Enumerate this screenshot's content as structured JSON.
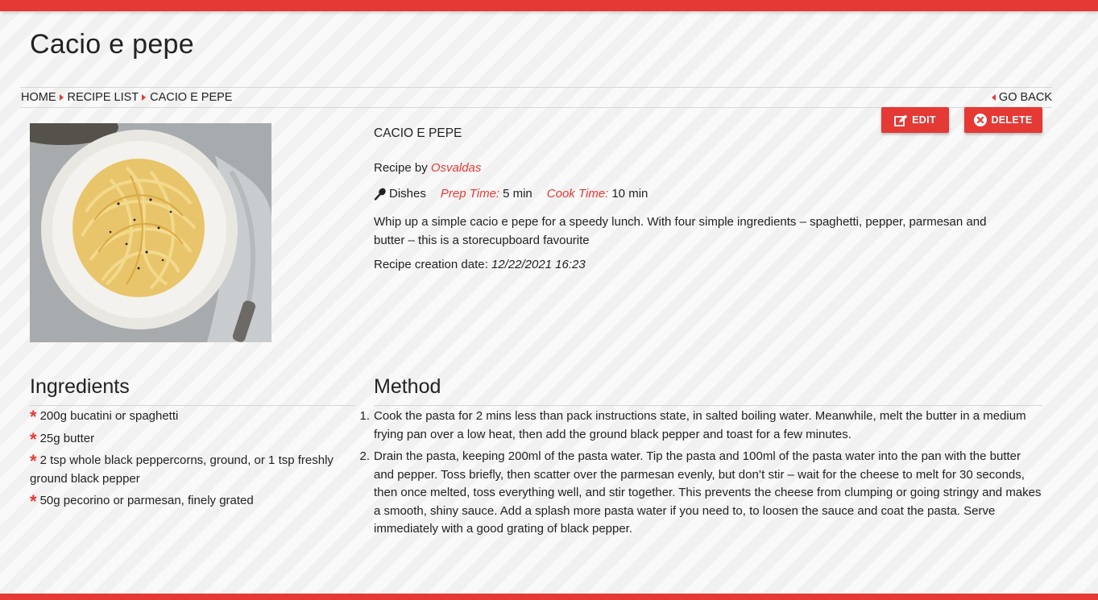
{
  "header": {
    "title": "Cacio e pepe"
  },
  "breadcrumb": {
    "items": [
      "HOME",
      "RECIPE LIST",
      "CACIO E PEPE"
    ],
    "back_label": "GO BACK"
  },
  "actions": {
    "edit_label": "EDIT",
    "delete_label": "DELETE"
  },
  "recipe": {
    "name": "CACIO E PEPE",
    "author_prefix": "Recipe by",
    "author": "Osvaldas",
    "category": "Dishes",
    "prep_label": "Prep Time:",
    "prep_value": "5 min",
    "cook_label": "Cook Time:",
    "cook_value": "10 min",
    "description": "Whip up a simple cacio e pepe for a speedy lunch. With four simple ingredients – spaghetti, pepper, parmesan and butter – this is a storecupboard favourite",
    "date_label": "Recipe creation date:",
    "date_value": "12/22/2021 16:23"
  },
  "ingredients": {
    "heading": "Ingredients",
    "items": [
      "200g bucatini or spaghetti",
      "25g butter",
      "2 tsp whole black peppercorns, ground, or 1 tsp freshly ground black pepper",
      "50g pecorino or parmesan, finely grated"
    ]
  },
  "method": {
    "heading": "Method",
    "steps": [
      "Cook the pasta for 2 mins less than pack instructions state, in salted boiling water. Meanwhile, melt the butter in a medium frying pan over a low heat, then add the ground black pepper and toast for a few minutes.",
      "Drain the pasta, keeping 200ml of the pasta water. Tip the pasta and 100ml of the pasta water into the pan with the butter and pepper. Toss briefly, then scatter over the parmesan evenly, but don’t stir – wait for the cheese to melt for 30 seconds, then once melted, toss everything well, and stir together. This prevents the cheese from clumping or going stringy and makes a smooth, shiny sauce. Add a splash more pasta water if you need to, to loosen the sauce and coat the pasta. Serve immediately with a good grating of black pepper."
    ]
  },
  "icons": {
    "edit": "edit-icon",
    "delete": "close-circle-icon",
    "category": "spoon-icon",
    "ingredient_bullet": "asterisk-icon"
  },
  "colors": {
    "accent": "#e53935",
    "text": "#222222"
  }
}
